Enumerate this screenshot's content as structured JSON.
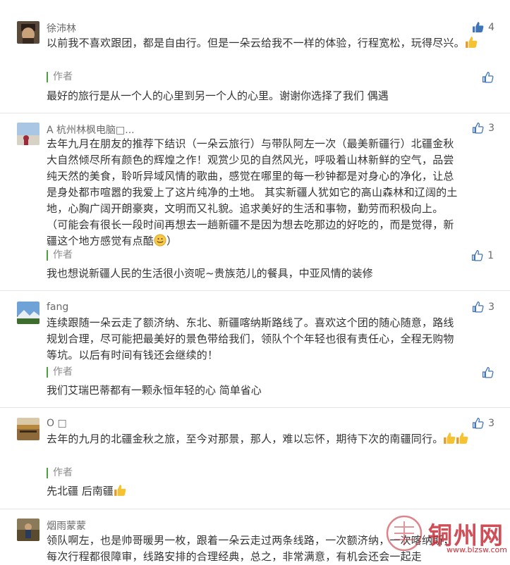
{
  "comments": [
    {
      "user": "徐沛林",
      "likes": "4",
      "text": "以前我不喜欢跟团，都是自由行。但是一朵云给我不一样的体验，行程宽松，玩得尽兴。",
      "reply_author": "作者",
      "reply_likes": "",
      "reply_text": "最好的旅行是从一个人的心里到另一个人的心里。谢谢你选择了我们 偶遇"
    },
    {
      "user": "A 杭州林枫电脑□...",
      "likes": "3",
      "text_lines": [
        "去年九月在朋友的推荐下结识（一朵云旅行）与带队阿左一次（最美新疆行）北疆金秋",
        "大自然倾尽所有颜色的辉煌之作！观赏少见的自然风光，呼吸着山林新鲜的空气，品尝",
        "纯天然的美食，聆听异域风情的歌曲，感觉在哪里的每一秒钟都是对身心的净化，让总",
        "是身处都市喧嚣的我爱上了这片纯净的土地。 其实新疆人犹如它的高山森林和辽阔的土",
        "地，心胸广阔开朗豪爽，文明而又礼貌。追求美好的生活和事物，勤劳而积极向上。",
        "（可能会有很长一段时间再想去一趟新疆不是因为想去吃那边的好吃的，而是觉得，新",
        "疆这个地方感觉有点酷"
      ],
      "text_tail": "）",
      "reply_author": "作者",
      "reply_likes": "1",
      "reply_text": "我也想说新疆人民的生活很小资呢~贵族范儿的餐具，中亚风情的装修"
    },
    {
      "user": "fang",
      "likes": "3",
      "text_lines": [
        "连续跟随一朵云走了额济纳、东北、新疆喀纳斯路线了。喜欢这个团的随心随意，路线",
        "规划合理，尽可能把最美好的景色带给我们，领队个个年轻也很有责任心，全程无购物",
        "等坑。以后有时间有钱还会继续的！"
      ],
      "reply_author": "作者",
      "reply_likes": "",
      "reply_text": "我们艾瑞巴蒂都有一颗永恒年轻的心 简单省心"
    },
    {
      "user": "O □",
      "likes": "3",
      "text": "去年的九月的北疆金秋之旅，至今对那景，那人，难以忘怀，期待下次的南疆同行。",
      "reply_author": "作者",
      "reply_likes": "",
      "reply_text": "先北疆 后南疆"
    },
    {
      "user": "烟雨蒙蒙",
      "likes": "",
      "text_lines": [
        "领队啊左，也是帅哥暖男一枚，跟着一朵云走过两条线路，一次额济纳，一次喀纳斯，",
        "每次行程都很障审，线路安排的合理经典，总之，非常满意，有机会还会一起走"
      ]
    }
  ],
  "watermark": {
    "text": "铜州网",
    "url": "www.blzsw.com"
  },
  "colors": {
    "accent_green": "#4aa33a",
    "thumb_blue": "#3f74b5",
    "watermark_red": "#c8303a"
  }
}
